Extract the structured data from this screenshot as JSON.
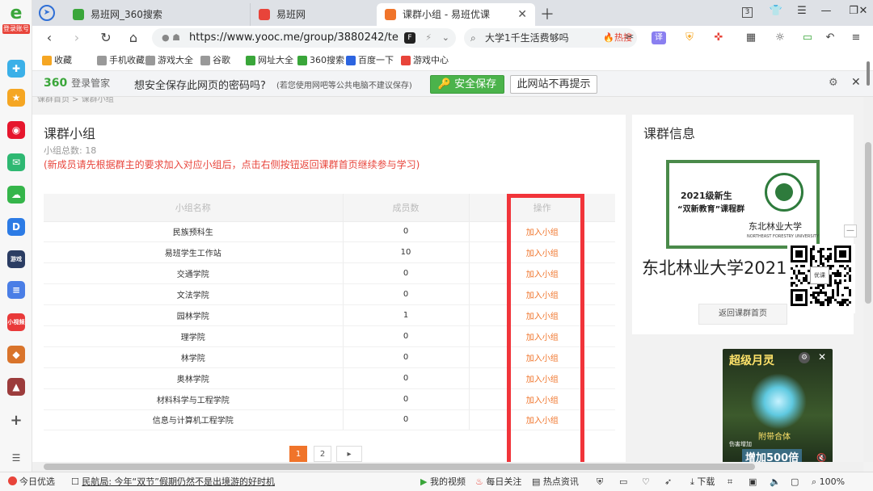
{
  "sidebar": {
    "account_label": "登录账号",
    "items": [
      {
        "icon": "plus-circle-icon",
        "color": "#3bb0e8",
        "text": "✚"
      },
      {
        "icon": "star-icon",
        "color": "#f5a623",
        "text": "★"
      },
      {
        "icon": "weibo-icon",
        "color": "#e6162d",
        "text": "◉"
      },
      {
        "icon": "mail-icon",
        "color": "#2eb872",
        "text": "✉"
      },
      {
        "icon": "cloud-icon",
        "color": "#35b54a",
        "text": "☁"
      },
      {
        "icon": "app-d-icon",
        "color": "#2c7be5",
        "text": "D"
      },
      {
        "icon": "game-app-icon",
        "color": "#2b3d63",
        "text": "游戏"
      },
      {
        "icon": "doc-icon",
        "color": "#4a7ee6",
        "text": "≡"
      },
      {
        "icon": "video-app-icon",
        "color": "#e93a3a",
        "text": "小视频"
      },
      {
        "icon": "game-app2-icon",
        "color": "#d9742b",
        "text": "◆"
      },
      {
        "icon": "game-app3-icon",
        "color": "#9c3c3c",
        "text": "▲"
      }
    ]
  },
  "tabs": [
    {
      "label": "易班网_360搜索",
      "favicon_color": "#3aa63a"
    },
    {
      "label": "易班网",
      "favicon_color": "#e8443a"
    },
    {
      "label": "课群小组 - 易班优课",
      "favicon_color": "#f0742a"
    }
  ],
  "window": {
    "tab_count": "3"
  },
  "address": {
    "url": "https://www.yooc.me/group/3880242/te",
    "search_text": "大学1千生活费够吗",
    "search_hot": "🔥热搜"
  },
  "bookmarks": [
    {
      "label": "收藏",
      "color": "#f5a623"
    },
    {
      "label": "手机收藏夹",
      "color": "#999999"
    },
    {
      "label": "游戏大全",
      "color": "#999999"
    },
    {
      "label": "谷歌",
      "color": "#999999"
    },
    {
      "label": "网址大全",
      "color": "#3aa63a"
    },
    {
      "label": "360搜索",
      "color": "#3aa63a"
    },
    {
      "label": "百度一下",
      "color": "#2c64e0"
    },
    {
      "label": "游戏中心",
      "color": "#e8443a"
    }
  ],
  "password_bar": {
    "brand": "360",
    "brand_sub": "登录管家",
    "question": "想安全保存此网页的密码吗?",
    "note": "(若您使用网吧等公共电脑不建议保存)",
    "save_label": "安全保存",
    "never_label": "此网站不再提示"
  },
  "page": {
    "breadcrumb": "课群首页 > 课群小组",
    "title": "课群小组",
    "total": "小组总数: 18",
    "warning": "(新成员请先根据群主的要求加入对应小组后，点击右侧按钮返回课群首页继续参与学习)",
    "columns": [
      "小组名称",
      "成员数",
      "操作"
    ],
    "rows": [
      {
        "name": "民族预科生",
        "members": "0",
        "action": "加入小组"
      },
      {
        "name": "易班学生工作站",
        "members": "10",
        "action": "加入小组"
      },
      {
        "name": "交通学院",
        "members": "0",
        "action": "加入小组"
      },
      {
        "name": "文法学院",
        "members": "0",
        "action": "加入小组"
      },
      {
        "name": "园林学院",
        "members": "1",
        "action": "加入小组"
      },
      {
        "name": "理学院",
        "members": "0",
        "action": "加入小组"
      },
      {
        "name": "林学院",
        "members": "0",
        "action": "加入小组"
      },
      {
        "name": "奥林学院",
        "members": "0",
        "action": "加入小组"
      },
      {
        "name": "材料科学与工程学院",
        "members": "0",
        "action": "加入小组"
      },
      {
        "name": "信息与计算机工程学院",
        "members": "0",
        "action": "加入小组"
      }
    ],
    "pager": [
      "1",
      "2",
      "▸"
    ],
    "side_title": "课群信息",
    "cover_line1": "2021级新生",
    "cover_line2": "“双新教育”课程群",
    "cover_school": "东北林业大学",
    "cover_school_en": "NORTHEAST FORESTRY UNIVERSITY",
    "group_name": "东北林业大学2021",
    "back_label": "返回课群首页",
    "qr_badge": "优课",
    "qr_min": "—",
    "accent": "#f0742a",
    "highlight_color": "#f1343a"
  },
  "ad": {
    "title": "超级月灵",
    "subtitle": "附带合体",
    "stat": "伤害增加",
    "big_text": "增加500倍",
    "close": "✕"
  },
  "statusbar": {
    "left": "今日优选",
    "news": "民航局: 今年“双节”假期仍然不是出境游的好时机",
    "video": "我的视频",
    "daily": "每日关注",
    "hot": "热点资讯",
    "download": "下载",
    "zoom": "100%"
  }
}
